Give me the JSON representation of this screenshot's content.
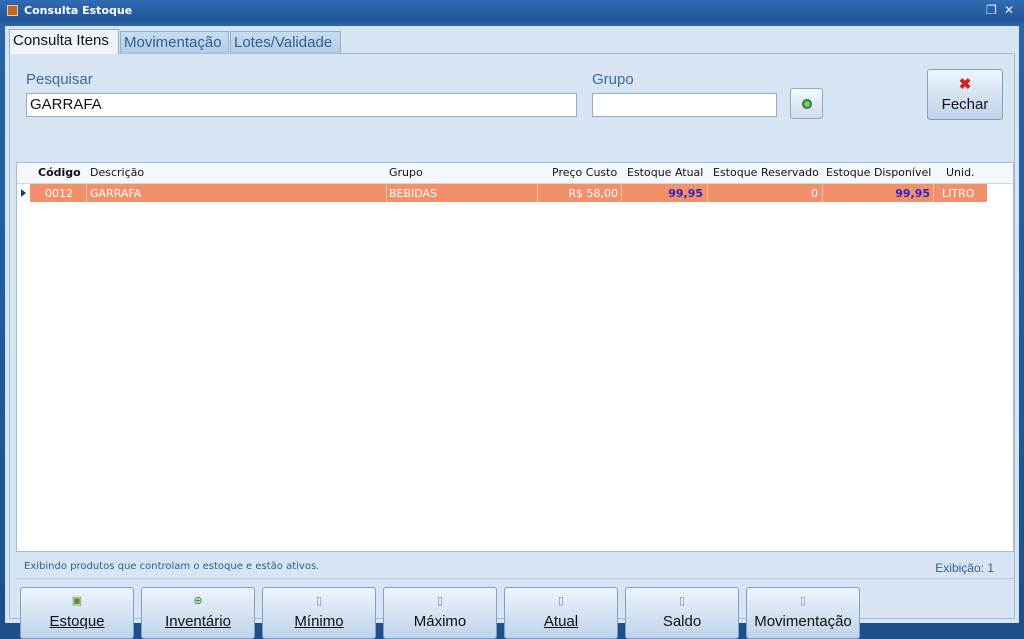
{
  "window": {
    "title": "Consulta Estoque",
    "restore_glyph": "❐",
    "close_glyph": "✕"
  },
  "tabs": [
    {
      "label": "Consulta Itens"
    },
    {
      "label": "Movimentação"
    },
    {
      "label": "Lotes/Validade"
    }
  ],
  "search": {
    "label": "Pesquisar",
    "value": "GARRAFA",
    "group_label": "Grupo",
    "group_value": "",
    "close_button_label": "Fechar"
  },
  "grid": {
    "columns": [
      "Código",
      "Descrição",
      "Grupo",
      "Preço Custo",
      "Estoque Atual",
      "Estoque Reservado",
      "Estoque Disponível",
      "Unid."
    ],
    "rows": [
      {
        "codigo": "0012",
        "descricao": "GARRAFA",
        "grupo": "BEBIDAS",
        "preco_custo": "R$ 58,00",
        "estoque_atual": "99,95",
        "estoque_reservado": "0",
        "estoque_disponivel": "99,95",
        "unid": "LITRO"
      }
    ]
  },
  "status": {
    "message": "Exibindo produtos que controlam o estoque e estão ativos.",
    "count": "Exibição: 1"
  },
  "buttons": {
    "estoque": "Estoque",
    "inventario": "Inventário",
    "minimo": "Mínimo",
    "maximo": "Máximo",
    "atual": "Atual",
    "saldo": "Saldo",
    "movimentacao": "Movimentação"
  },
  "colors": {
    "selected_row": "#f3906a",
    "highlight_value": "#2c24c9",
    "window_frame": "#1f4f86"
  }
}
